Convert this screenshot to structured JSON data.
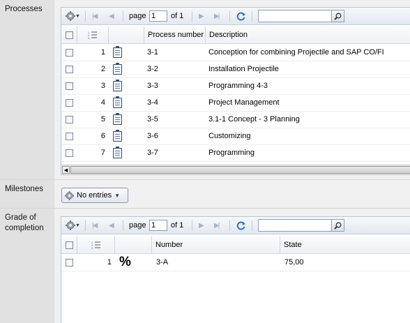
{
  "sections": {
    "processes": "Processes",
    "milestones": "Milestones",
    "grade": "Grade of completion"
  },
  "toolbar": {
    "page_label": "page",
    "page_value": "1",
    "of_label": "of 1",
    "search_value": ""
  },
  "processes_grid": {
    "columns": [
      "",
      "",
      "",
      "Process number",
      "Description"
    ],
    "rows": [
      {
        "index": "1",
        "number": "3-1",
        "description": "Conception for combining Projectile and SAP CO/FI"
      },
      {
        "index": "2",
        "number": "3-2",
        "description": "Installation Projectile"
      },
      {
        "index": "3",
        "number": "3-3",
        "description": "Programming 4-3"
      },
      {
        "index": "4",
        "number": "3-4",
        "description": "Project Management"
      },
      {
        "index": "5",
        "number": "3-5",
        "description": "3.1-1 Concept - 3 Planning"
      },
      {
        "index": "6",
        "number": "3-6",
        "description": "Customizing"
      },
      {
        "index": "7",
        "number": "3-7",
        "description": "Programming"
      }
    ]
  },
  "milestones": {
    "button_label": "No entries"
  },
  "grade_grid": {
    "columns": [
      "",
      "",
      "",
      "Number",
      "State"
    ],
    "rows": [
      {
        "index": "1",
        "symbol": "%",
        "number": "3-A",
        "state": "75,00"
      }
    ]
  },
  "icons": {
    "gear": "gear-icon",
    "list_numbers": "numbered-list-icon",
    "clipboard": "clipboard-icon",
    "refresh": "refresh-icon",
    "search": "search-icon",
    "percent": "percent-icon"
  }
}
